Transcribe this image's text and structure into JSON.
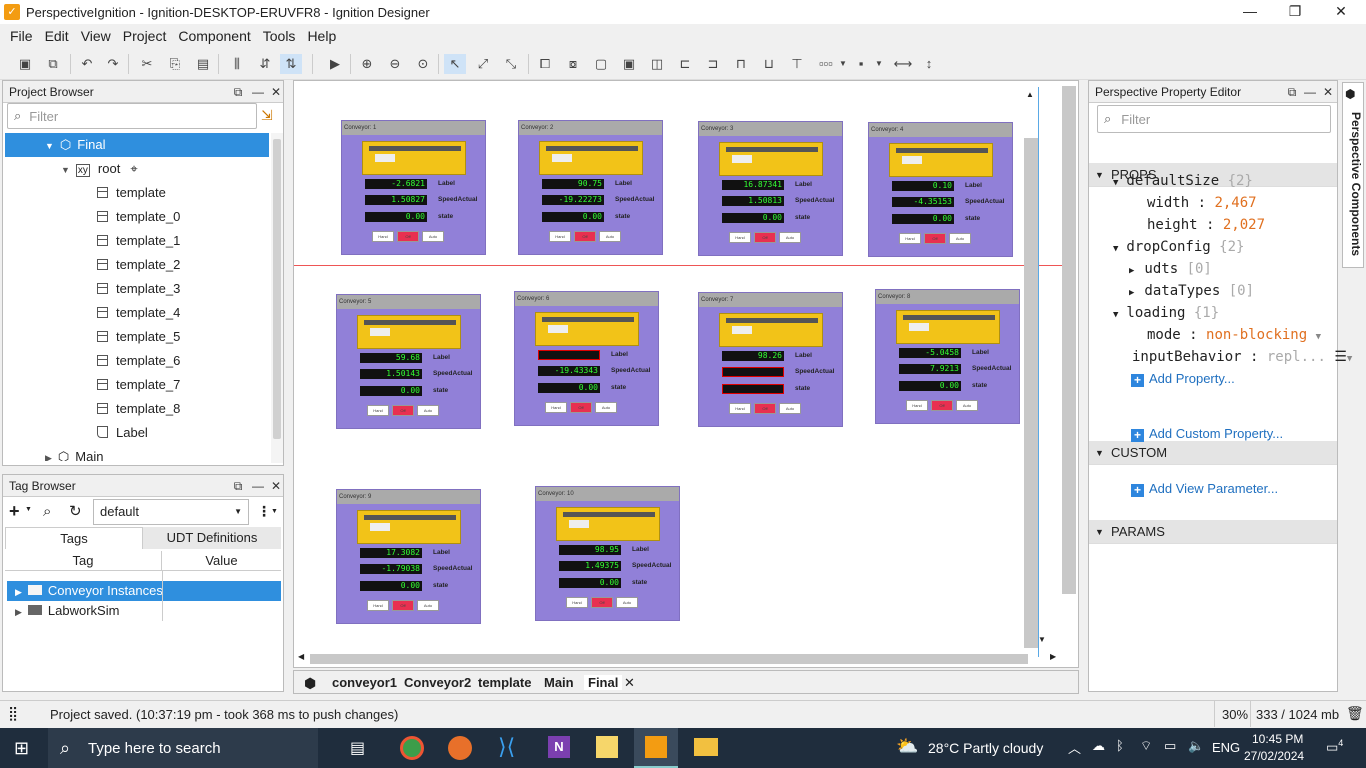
{
  "window": {
    "title": "PerspectiveIgnition - Ignition-DESKTOP-ERUVFR8 - Ignition Designer",
    "minimize": "—",
    "maximize": "❐",
    "close": "✕"
  },
  "menu": [
    "File",
    "Edit",
    "View",
    "Project",
    "Component",
    "Tools",
    "Help"
  ],
  "project_browser": {
    "title": "Project Browser",
    "filter_placeholder": "Filter",
    "items": [
      {
        "label": "Final",
        "level": 0,
        "type": "view",
        "selected": true
      },
      {
        "label": "root",
        "level": 1,
        "type": "root"
      },
      {
        "label": "template",
        "level": 2,
        "type": "comp"
      },
      {
        "label": "template_0",
        "level": 2,
        "type": "comp"
      },
      {
        "label": "template_1",
        "level": 2,
        "type": "comp"
      },
      {
        "label": "template_2",
        "level": 2,
        "type": "comp"
      },
      {
        "label": "template_3",
        "level": 2,
        "type": "comp"
      },
      {
        "label": "template_4",
        "level": 2,
        "type": "comp"
      },
      {
        "label": "template_5",
        "level": 2,
        "type": "comp"
      },
      {
        "label": "template_6",
        "level": 2,
        "type": "comp"
      },
      {
        "label": "template_7",
        "level": 2,
        "type": "comp"
      },
      {
        "label": "template_8",
        "level": 2,
        "type": "comp"
      },
      {
        "label": "Label",
        "level": 2,
        "type": "label"
      },
      {
        "label": "Main",
        "level": 0,
        "type": "view"
      }
    ]
  },
  "tag_browser": {
    "title": "Tag Browser",
    "provider": "default",
    "tabs": [
      "Tags",
      "UDT Definitions"
    ],
    "columns": [
      "Tag",
      "Value"
    ],
    "rows": [
      {
        "name": "Conveyor Instances",
        "value": "",
        "selected": true
      },
      {
        "name": "LabworkSim",
        "value": ""
      }
    ]
  },
  "canvas": {
    "templates": [
      {
        "title": "Conveyor: 1",
        "values": [
          "-2.6821",
          "1.50827",
          "0.00"
        ]
      },
      {
        "title": "Conveyor: 2",
        "values": [
          "90.75",
          "-19.22273",
          "0.00"
        ]
      },
      {
        "title": "Conveyor: 3",
        "values": [
          "16.87341",
          "1.50813",
          "0.00"
        ]
      },
      {
        "title": "Conveyor: 4",
        "values": [
          "0.10",
          "-4.35153",
          "0.00"
        ]
      },
      {
        "title": "Conveyor: 5",
        "values": [
          "59.68",
          "1.50143",
          "0.00"
        ]
      },
      {
        "title": "Conveyor: 6",
        "values": [
          "",
          "-19.43343",
          "0.00"
        ]
      },
      {
        "title": "Conveyor: 7",
        "values": [
          "98.26",
          "",
          ""
        ]
      },
      {
        "title": "Conveyor: 8",
        "values": [
          "-5.0458",
          "7.9213",
          "0.00"
        ]
      },
      {
        "title": "Conveyor: 9",
        "values": [
          "17.3082",
          "-1.79038",
          "0.00"
        ]
      },
      {
        "title": "Conveyor: 10",
        "values": [
          "98.95",
          "1.49375",
          "0.00"
        ]
      }
    ],
    "field_labels": [
      "Label",
      "SpeedActual",
      "state"
    ],
    "buttons": [
      "Hand",
      "Off",
      "Auto"
    ]
  },
  "view_tabs": [
    "conveyor1",
    "Conveyor2",
    "template",
    "Main",
    "Final"
  ],
  "property_editor": {
    "title": "Perspective Property Editor",
    "filter_placeholder": "Filter",
    "side_tab": "Perspective Components",
    "props_section": "PROPS",
    "custom_section": "CUSTOM",
    "params_section": "PARAMS",
    "defaultSize": {
      "key": "defaultSize",
      "count": "{2}",
      "width_key": "width",
      "width": "2,467",
      "height_key": "height",
      "height": "2,027"
    },
    "dropConfig": {
      "key": "dropConfig",
      "count": "{2}",
      "udts_key": "udts",
      "udts": "[0]",
      "dataTypes_key": "dataTypes",
      "dataTypes": "[0]"
    },
    "loading": {
      "key": "loading",
      "count": "{1}",
      "mode_key": "mode",
      "mode": "non-blocking"
    },
    "inputBehavior": {
      "key": "inputBehavior",
      "value": "repl..."
    },
    "add_property": "Add Property...",
    "add_custom": "Add Custom Property...",
    "add_param": "Add View Parameter..."
  },
  "status": {
    "message": "Project saved. (10:37:19 pm - took 368 ms to push changes)",
    "zoom": "30%",
    "memory": "333 / 1024 mb"
  },
  "taskbar": {
    "search": "Type here to search",
    "weather": "28°C  Partly cloudy",
    "lang": "ENG",
    "time": "10:45 PM",
    "date": "27/02/2024",
    "notifications": "4"
  }
}
